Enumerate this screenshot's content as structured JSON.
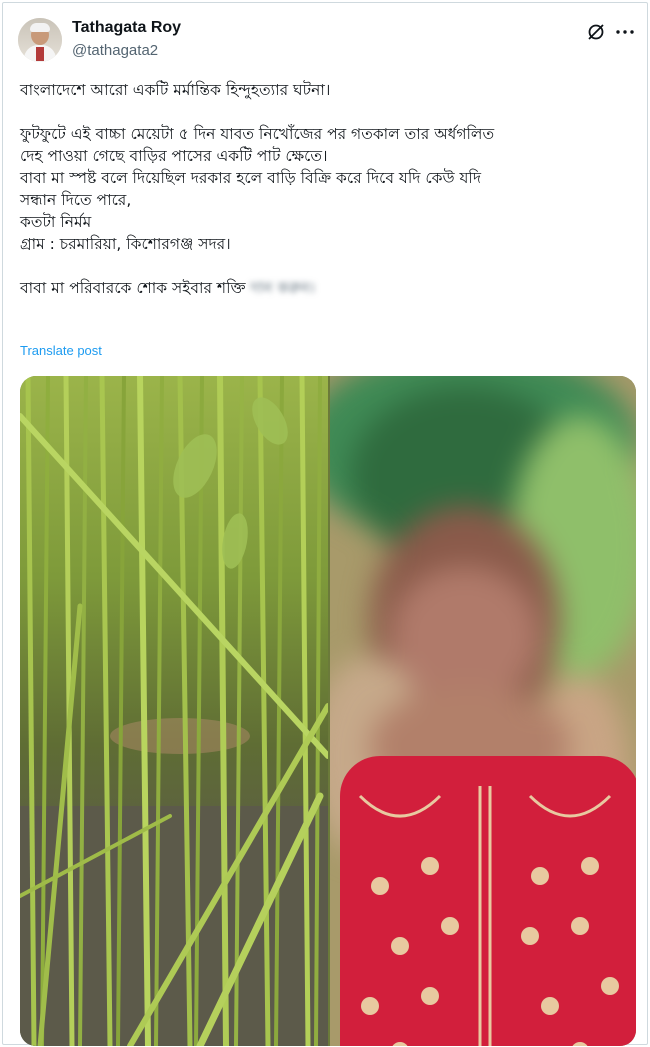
{
  "author": {
    "name": "Tathagata Roy",
    "handle": "@tathagata2"
  },
  "icons": {
    "grok": "grok-icon",
    "more": "more-options-icon"
  },
  "tweet": {
    "lines": [
      "বাংলাদেশে আরো একটি মর্মান্তিক হিন্দুহত্যার ঘটনা।",
      "",
      "ফুটফুটে এই বাচ্চা মেয়েটা ৫ দিন যাবত নিখোঁজের পর  গতকাল  তার অর্ধগলিত",
      "দেহ পাওয়া গেছে বাড়ির পাসের একটি পাট ক্ষেতে।",
      " বাবা মা স্পষ্ট বলে দিয়েছিল দরকার হলে বাড়ি বিক্রি করে দিবে যদি কেউ যদি",
      "সন্ধান দিতে পারে,",
      "কতটা নির্মম",
      "গ্রাম : চরমারিয়া, কিশোরগঞ্জ সদর।",
      "",
      " বাবা মা পরিবারকে শোক সইবার শক্তি"
    ],
    "blurred_suffix": "দান করুন।"
  },
  "translate_label": "Translate post",
  "colors": {
    "link": "#1d9bf0",
    "secondary_text": "#536471",
    "border": "#cfd9de"
  }
}
